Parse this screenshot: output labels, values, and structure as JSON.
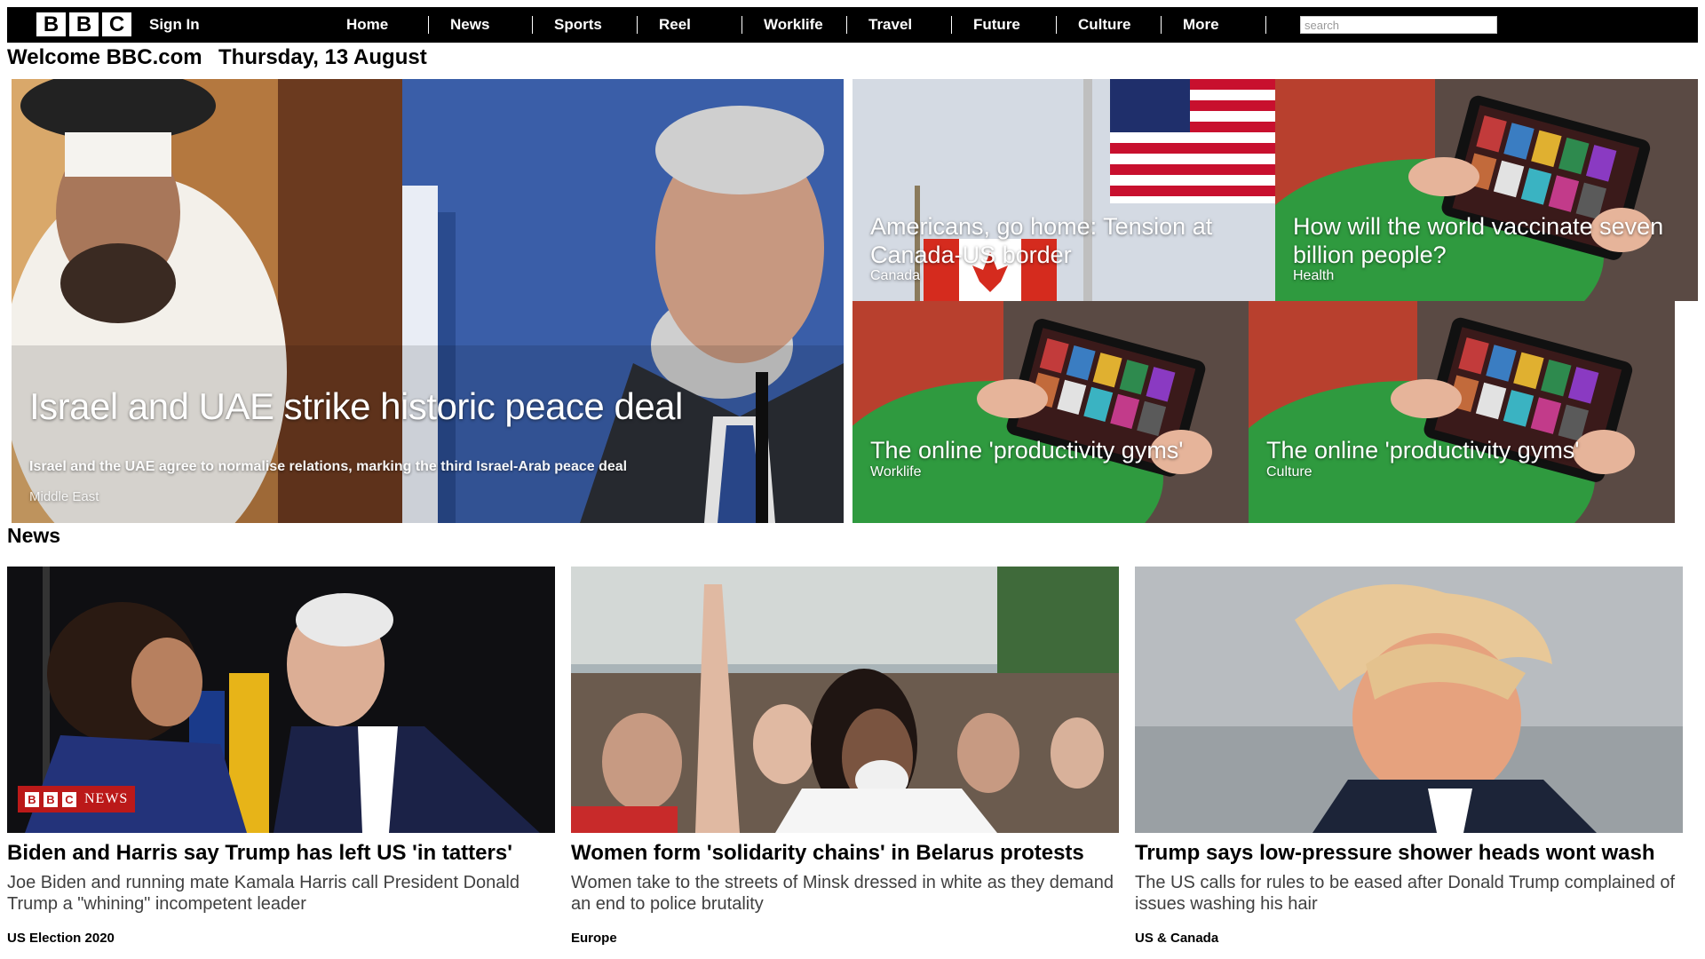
{
  "topbar": {
    "logo_letters": [
      "B",
      "B",
      "C"
    ],
    "signin_label": "Sign In",
    "nav": [
      "Home",
      "News",
      "Sports",
      "Reel",
      "Worklife",
      "Travel",
      "Future",
      "Culture",
      "More"
    ],
    "search_placeholder": "search"
  },
  "welcome": {
    "title": "Welcome BBC.com",
    "date": "Thursday, 13 August"
  },
  "hero": {
    "main": {
      "title": "Israel and UAE strike historic peace deal",
      "summary": "Israel and the UAE agree to normalise relations, marking the third Israel-Arab peace deal",
      "tag": "Middle East"
    },
    "tiles": [
      {
        "title": "Americans, go home: Tension at Canada-US border",
        "tag": "Canada"
      },
      {
        "title": "How will the world vaccinate seven billion people?",
        "tag": "Health"
      },
      {
        "title": "The online 'productivity gyms'",
        "tag": "Worklife"
      },
      {
        "title": "The online 'productivity gyms'",
        "tag": "Culture"
      }
    ]
  },
  "news": {
    "heading": "News",
    "badge": {
      "letters": [
        "B",
        "B",
        "C"
      ],
      "word": "NEWS"
    },
    "cards": [
      {
        "title": "Biden and Harris say Trump has left US 'in tatters'",
        "summary": "Joe Biden and running mate Kamala Harris call President Donald Trump a \"whining\" incompetent leader",
        "tag": "US Election 2020"
      },
      {
        "title": "Women form 'solidarity chains' in Belarus protests",
        "summary": "Women take to the streets of Minsk dressed in white as they demand an end to police brutality",
        "tag": "Europe"
      },
      {
        "title": "Trump says low-pressure shower heads wont wash",
        "summary": "The US calls for rules to be eased after Donald Trump complained of issues washing his hair",
        "tag": "US & Canada"
      }
    ]
  }
}
